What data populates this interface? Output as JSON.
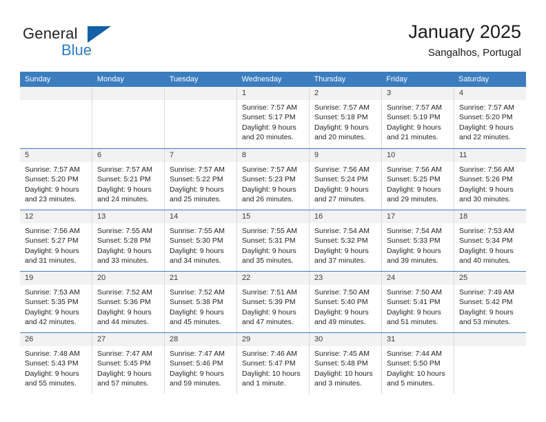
{
  "brand": {
    "word_general": "General",
    "word_blue": "Blue",
    "mark": "triangle-logo"
  },
  "header": {
    "title": "January 2025",
    "subtitle": "Sangalhos, Portugal"
  },
  "colors": {
    "header_blue": "#3b7dbf",
    "brand_blue": "#2b7cc4",
    "mark_blue": "#145fa6",
    "day_band_gray": "#f2f2f2",
    "cell_border": "#d9d9d9"
  },
  "calendar": {
    "weekdays": [
      "Sunday",
      "Monday",
      "Tuesday",
      "Wednesday",
      "Thursday",
      "Friday",
      "Saturday"
    ],
    "weeks": [
      [
        {
          "day": "",
          "sunrise": "",
          "sunset": "",
          "daylight": "",
          "empty": true
        },
        {
          "day": "",
          "sunrise": "",
          "sunset": "",
          "daylight": "",
          "empty": true
        },
        {
          "day": "",
          "sunrise": "",
          "sunset": "",
          "daylight": "",
          "empty": true
        },
        {
          "day": "1",
          "sunrise": "Sunrise: 7:57 AM",
          "sunset": "Sunset: 5:17 PM",
          "daylight": "Daylight: 9 hours and 20 minutes.",
          "empty": false
        },
        {
          "day": "2",
          "sunrise": "Sunrise: 7:57 AM",
          "sunset": "Sunset: 5:18 PM",
          "daylight": "Daylight: 9 hours and 20 minutes.",
          "empty": false
        },
        {
          "day": "3",
          "sunrise": "Sunrise: 7:57 AM",
          "sunset": "Sunset: 5:19 PM",
          "daylight": "Daylight: 9 hours and 21 minutes.",
          "empty": false
        },
        {
          "day": "4",
          "sunrise": "Sunrise: 7:57 AM",
          "sunset": "Sunset: 5:20 PM",
          "daylight": "Daylight: 9 hours and 22 minutes.",
          "empty": false
        }
      ],
      [
        {
          "day": "5",
          "sunrise": "Sunrise: 7:57 AM",
          "sunset": "Sunset: 5:20 PM",
          "daylight": "Daylight: 9 hours and 23 minutes.",
          "empty": false
        },
        {
          "day": "6",
          "sunrise": "Sunrise: 7:57 AM",
          "sunset": "Sunset: 5:21 PM",
          "daylight": "Daylight: 9 hours and 24 minutes.",
          "empty": false
        },
        {
          "day": "7",
          "sunrise": "Sunrise: 7:57 AM",
          "sunset": "Sunset: 5:22 PM",
          "daylight": "Daylight: 9 hours and 25 minutes.",
          "empty": false
        },
        {
          "day": "8",
          "sunrise": "Sunrise: 7:57 AM",
          "sunset": "Sunset: 5:23 PM",
          "daylight": "Daylight: 9 hours and 26 minutes.",
          "empty": false
        },
        {
          "day": "9",
          "sunrise": "Sunrise: 7:56 AM",
          "sunset": "Sunset: 5:24 PM",
          "daylight": "Daylight: 9 hours and 27 minutes.",
          "empty": false
        },
        {
          "day": "10",
          "sunrise": "Sunrise: 7:56 AM",
          "sunset": "Sunset: 5:25 PM",
          "daylight": "Daylight: 9 hours and 29 minutes.",
          "empty": false
        },
        {
          "day": "11",
          "sunrise": "Sunrise: 7:56 AM",
          "sunset": "Sunset: 5:26 PM",
          "daylight": "Daylight: 9 hours and 30 minutes.",
          "empty": false
        }
      ],
      [
        {
          "day": "12",
          "sunrise": "Sunrise: 7:56 AM",
          "sunset": "Sunset: 5:27 PM",
          "daylight": "Daylight: 9 hours and 31 minutes.",
          "empty": false
        },
        {
          "day": "13",
          "sunrise": "Sunrise: 7:55 AM",
          "sunset": "Sunset: 5:28 PM",
          "daylight": "Daylight: 9 hours and 33 minutes.",
          "empty": false
        },
        {
          "day": "14",
          "sunrise": "Sunrise: 7:55 AM",
          "sunset": "Sunset: 5:30 PM",
          "daylight": "Daylight: 9 hours and 34 minutes.",
          "empty": false
        },
        {
          "day": "15",
          "sunrise": "Sunrise: 7:55 AM",
          "sunset": "Sunset: 5:31 PM",
          "daylight": "Daylight: 9 hours and 35 minutes.",
          "empty": false
        },
        {
          "day": "16",
          "sunrise": "Sunrise: 7:54 AM",
          "sunset": "Sunset: 5:32 PM",
          "daylight": "Daylight: 9 hours and 37 minutes.",
          "empty": false
        },
        {
          "day": "17",
          "sunrise": "Sunrise: 7:54 AM",
          "sunset": "Sunset: 5:33 PM",
          "daylight": "Daylight: 9 hours and 39 minutes.",
          "empty": false
        },
        {
          "day": "18",
          "sunrise": "Sunrise: 7:53 AM",
          "sunset": "Sunset: 5:34 PM",
          "daylight": "Daylight: 9 hours and 40 minutes.",
          "empty": false
        }
      ],
      [
        {
          "day": "19",
          "sunrise": "Sunrise: 7:53 AM",
          "sunset": "Sunset: 5:35 PM",
          "daylight": "Daylight: 9 hours and 42 minutes.",
          "empty": false
        },
        {
          "day": "20",
          "sunrise": "Sunrise: 7:52 AM",
          "sunset": "Sunset: 5:36 PM",
          "daylight": "Daylight: 9 hours and 44 minutes.",
          "empty": false
        },
        {
          "day": "21",
          "sunrise": "Sunrise: 7:52 AM",
          "sunset": "Sunset: 5:38 PM",
          "daylight": "Daylight: 9 hours and 45 minutes.",
          "empty": false
        },
        {
          "day": "22",
          "sunrise": "Sunrise: 7:51 AM",
          "sunset": "Sunset: 5:39 PM",
          "daylight": "Daylight: 9 hours and 47 minutes.",
          "empty": false
        },
        {
          "day": "23",
          "sunrise": "Sunrise: 7:50 AM",
          "sunset": "Sunset: 5:40 PM",
          "daylight": "Daylight: 9 hours and 49 minutes.",
          "empty": false
        },
        {
          "day": "24",
          "sunrise": "Sunrise: 7:50 AM",
          "sunset": "Sunset: 5:41 PM",
          "daylight": "Daylight: 9 hours and 51 minutes.",
          "empty": false
        },
        {
          "day": "25",
          "sunrise": "Sunrise: 7:49 AM",
          "sunset": "Sunset: 5:42 PM",
          "daylight": "Daylight: 9 hours and 53 minutes.",
          "empty": false
        }
      ],
      [
        {
          "day": "26",
          "sunrise": "Sunrise: 7:48 AM",
          "sunset": "Sunset: 5:43 PM",
          "daylight": "Daylight: 9 hours and 55 minutes.",
          "empty": false
        },
        {
          "day": "27",
          "sunrise": "Sunrise: 7:47 AM",
          "sunset": "Sunset: 5:45 PM",
          "daylight": "Daylight: 9 hours and 57 minutes.",
          "empty": false
        },
        {
          "day": "28",
          "sunrise": "Sunrise: 7:47 AM",
          "sunset": "Sunset: 5:46 PM",
          "daylight": "Daylight: 9 hours and 59 minutes.",
          "empty": false
        },
        {
          "day": "29",
          "sunrise": "Sunrise: 7:46 AM",
          "sunset": "Sunset: 5:47 PM",
          "daylight": "Daylight: 10 hours and 1 minute.",
          "empty": false
        },
        {
          "day": "30",
          "sunrise": "Sunrise: 7:45 AM",
          "sunset": "Sunset: 5:48 PM",
          "daylight": "Daylight: 10 hours and 3 minutes.",
          "empty": false
        },
        {
          "day": "31",
          "sunrise": "Sunrise: 7:44 AM",
          "sunset": "Sunset: 5:50 PM",
          "daylight": "Daylight: 10 hours and 5 minutes.",
          "empty": false
        },
        {
          "day": "",
          "sunrise": "",
          "sunset": "",
          "daylight": "",
          "empty": true
        }
      ]
    ]
  }
}
